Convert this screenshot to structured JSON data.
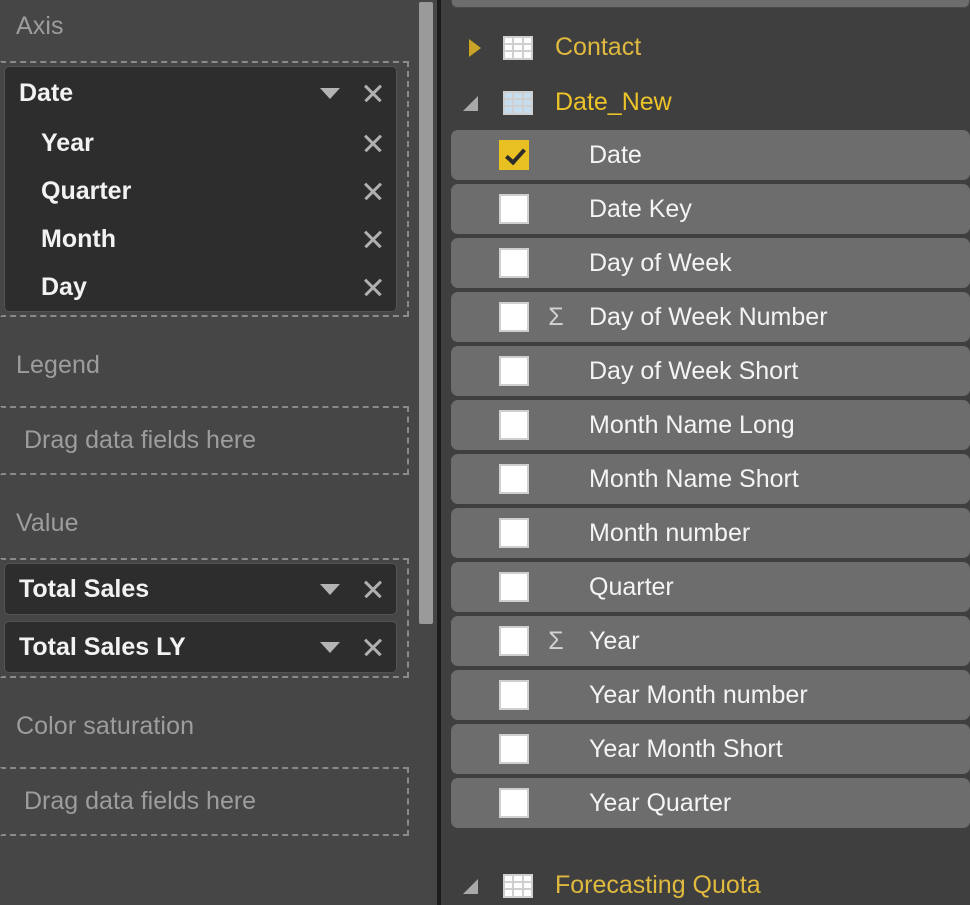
{
  "wells": {
    "sections": [
      {
        "label": "Axis",
        "field": {
          "name": "Date",
          "caret_icon": "chevron-down-icon",
          "remove_icon": "close-icon",
          "children": [
            {
              "name": "Year",
              "remove_icon": "close-icon"
            },
            {
              "name": "Quarter",
              "remove_icon": "close-icon"
            },
            {
              "name": "Month",
              "remove_icon": "close-icon"
            },
            {
              "name": "Day",
              "remove_icon": "close-icon"
            }
          ]
        }
      },
      {
        "label": "Legend",
        "placeholder": "Drag data fields here"
      },
      {
        "label": "Value",
        "fields": [
          {
            "name": "Total Sales",
            "caret_icon": "chevron-down-icon",
            "remove_icon": "close-icon"
          },
          {
            "name": "Total Sales LY",
            "caret_icon": "chevron-down-icon",
            "remove_icon": "close-icon"
          }
        ]
      },
      {
        "label": "Color saturation",
        "placeholder": "Drag data fields here"
      }
    ],
    "scrollbar": {
      "name": "vertical-scrollbar"
    }
  },
  "fields_pane": {
    "tables": [
      {
        "name": "Contact",
        "expanded": false,
        "expander_icon": "chevron-right-icon",
        "table_icon": "table-grid-icon",
        "fields": []
      },
      {
        "name": "Date_New",
        "expanded": true,
        "expander_icon": "chevron-down-icon",
        "table_icon": "table-grid-icon",
        "active": true,
        "fields": [
          {
            "name": "Date",
            "checked": true,
            "numeric": false
          },
          {
            "name": "Date Key",
            "checked": false,
            "numeric": false
          },
          {
            "name": "Day of Week",
            "checked": false,
            "numeric": false
          },
          {
            "name": "Day of Week Number",
            "checked": false,
            "numeric": true
          },
          {
            "name": "Day of Week Short",
            "checked": false,
            "numeric": false
          },
          {
            "name": "Month Name Long",
            "checked": false,
            "numeric": false
          },
          {
            "name": "Month Name Short",
            "checked": false,
            "numeric": false
          },
          {
            "name": "Month number",
            "checked": false,
            "numeric": false
          },
          {
            "name": "Quarter",
            "checked": false,
            "numeric": false
          },
          {
            "name": "Year",
            "checked": false,
            "numeric": true
          },
          {
            "name": "Year Month number",
            "checked": false,
            "numeric": false
          },
          {
            "name": "Year Month Short",
            "checked": false,
            "numeric": false
          },
          {
            "name": "Year Quarter",
            "checked": false,
            "numeric": false
          }
        ]
      },
      {
        "name": "Forecasting Quota",
        "expanded": true,
        "expander_icon": "chevron-down-icon",
        "table_icon": "table-grid-icon",
        "clipped": true,
        "fields": []
      }
    ],
    "sigma_glyph": "Σ"
  },
  "colors": {
    "pane_background": "#464646",
    "fields_background": "#3f3f3f",
    "field_row": "#6d6d6d",
    "chip_background": "#2d2d2d",
    "accent_gold": "#e8c022",
    "table_name": "#e0b93f",
    "muted_label": "#9d9d9d",
    "divider": "#1c1c1c"
  }
}
